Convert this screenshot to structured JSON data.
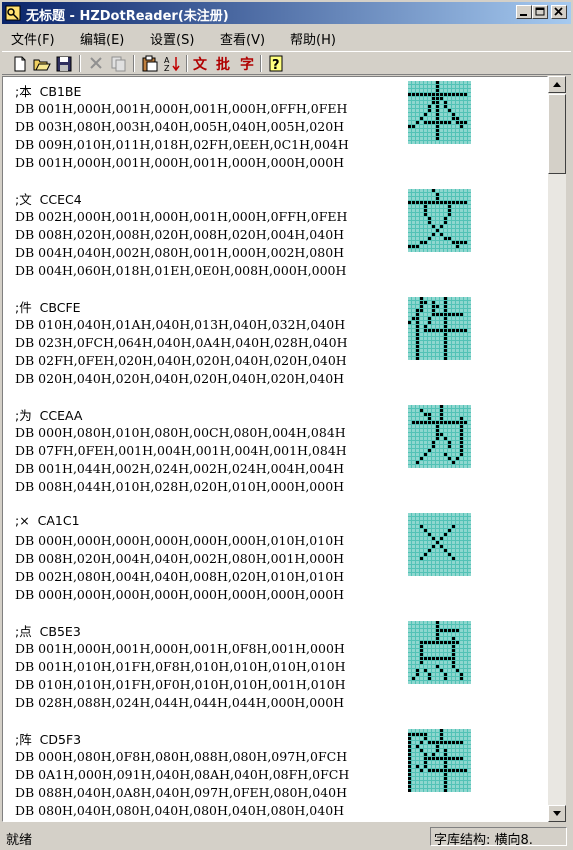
{
  "window": {
    "title": "无标题 - HZDotReader(未注册)",
    "title_icon": "app-key-icon",
    "controls": [
      "minimize-icon",
      "maximize-icon",
      "close-icon"
    ],
    "accent": "#0a246a"
  },
  "menu": [
    {
      "label": "文件(F)"
    },
    {
      "label": "编辑(E)"
    },
    {
      "label": "设置(S)"
    },
    {
      "label": "查看(V)"
    },
    {
      "label": "帮助(H)"
    }
  ],
  "toolbar": {
    "icons": [
      "new-file-icon",
      "open-folder-icon",
      "save-icon",
      "delete-icon",
      "copy-icon",
      "paste-icon",
      "sort-icon",
      "help-icon"
    ],
    "text_buttons": [
      "文",
      "批",
      "字"
    ]
  },
  "glyph_color": "#52c2b6",
  "entries": [
    {
      "head": ";本  CB1BE",
      "lines": [
        "DB 001H,000H,001H,000H,001H,000H,0FFH,0FEH",
        "DB 003H,080H,003H,040H,005H,040H,005H,020H",
        "DB 009H,010H,011H,018H,02FH,0EEH,0C1H,004H",
        "DB 001H,000H,001H,000H,001H,000H,000H,000H"
      ]
    },
    {
      "head": ";文  CCEC4",
      "lines": [
        "DB 002H,000H,001H,000H,001H,000H,0FFH,0FEH",
        "DB 008H,020H,008H,020H,008H,020H,004H,040H",
        "DB 004H,040H,002H,080H,001H,000H,002H,080H",
        "DB 004H,060H,018H,01EH,0E0H,008H,000H,000H"
      ]
    },
    {
      "head": ";件  CBCFE",
      "lines": [
        "DB 010H,040H,01AH,040H,013H,040H,032H,040H",
        "DB 023H,0FCH,064H,040H,0A4H,040H,028H,040H",
        "DB 02FH,0FEH,020H,040H,020H,040H,020H,040H",
        "DB 020H,040H,020H,040H,020H,040H,020H,040H"
      ]
    },
    {
      "head": ";为  CCEAA",
      "lines": [
        "DB 000H,080H,010H,080H,00CH,080H,004H,084H",
        "DB 07FH,0FEH,001H,004H,001H,004H,001H,084H",
        "DB 001H,044H,002H,024H,002H,024H,004H,004H",
        "DB 008H,044H,010H,028H,020H,010H,000H,000H"
      ]
    },
    {
      "head": ";×  CA1C1",
      "lines": [
        "DB 000H,000H,000H,000H,000H,000H,010H,010H",
        "DB 008H,020H,004H,040H,002H,080H,001H,000H",
        "DB 002H,080H,004H,040H,008H,020H,010H,010H",
        "DB 000H,000H,000H,000H,000H,000H,000H,000H"
      ]
    },
    {
      "head": ";点  CB5E3",
      "lines": [
        "DB 001H,000H,001H,000H,001H,0F8H,001H,000H",
        "DB 001H,010H,01FH,0F8H,010H,010H,010H,010H",
        "DB 010H,010H,01FH,0F0H,010H,010H,001H,010H",
        "DB 028H,088H,024H,044H,044H,044H,000H,000H"
      ]
    },
    {
      "head": ";阵  CD5F3",
      "lines": [
        "DB 000H,080H,0F8H,080H,088H,080H,097H,0FCH",
        "DB 0A1H,000H,091H,040H,08AH,040H,08FH,0FCH",
        "DB 088H,040H,0A8H,040H,097H,0FEH,080H,040H",
        "DB 080H,040H,080H,040H,080H,040H,080H,040H"
      ]
    }
  ],
  "scrollbar": {
    "up_icon": "scroll-up-arrow-icon",
    "down_icon": "scroll-down-arrow-icon"
  },
  "status": {
    "left": "就绪",
    "right": "字库结构: 横向8."
  }
}
